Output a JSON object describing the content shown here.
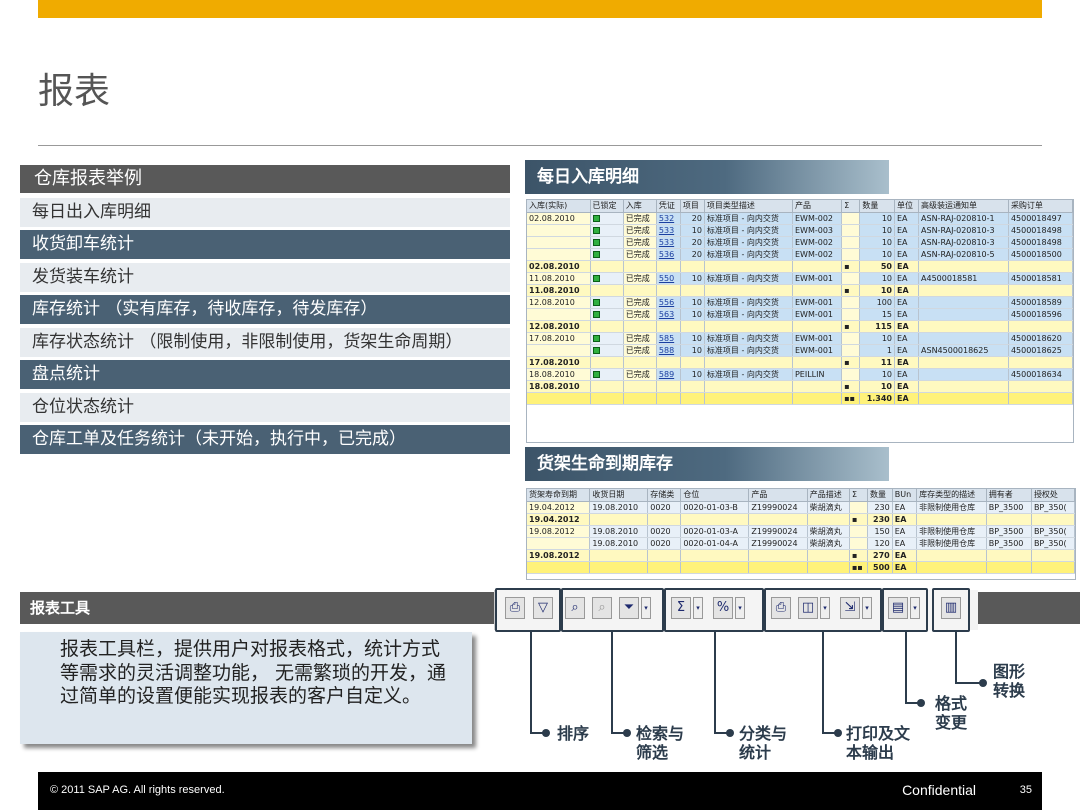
{
  "slide": {
    "title": "报表"
  },
  "left_panel": {
    "heading": "仓库报表举例",
    "items": [
      "每日出入库明细",
      "收货卸车统计",
      "发货装车统计",
      "库存统计 （实有库存，待收库存，待发库存）",
      "库存状态统计 （限制使用，非限制使用，货架生命周期）",
      "盘点统计",
      "仓位状态统计",
      "仓库工单及任务统计（未开始，执行中，已完成）"
    ]
  },
  "panel1": {
    "title": "每日入库明细",
    "headers": [
      "入库(实际)",
      "已锁定",
      "入库",
      "凭证",
      "项目",
      "项目类型描述",
      "产品",
      "Σ",
      "数量",
      "单位",
      "高级装运通知单",
      "采购订单"
    ],
    "rows": [
      {
        "type": "row",
        "date": "02.08.2010",
        "status": "已完成",
        "doc": "532",
        "item": "20",
        "desc": "标准项目 - 向内交货",
        "product": "EWM-002",
        "qty": "10",
        "unit": "EA",
        "asn": "ASN-RAJ-020810-1",
        "po": "4500018497"
      },
      {
        "type": "row",
        "date": "",
        "status": "已完成",
        "doc": "533",
        "item": "10",
        "desc": "标准项目 - 向内交货",
        "product": "EWM-003",
        "qty": "10",
        "unit": "EA",
        "asn": "ASN-RAJ-020810-3",
        "po": "4500018498"
      },
      {
        "type": "row",
        "date": "",
        "status": "已完成",
        "doc": "533",
        "item": "20",
        "desc": "标准项目 - 向内交货",
        "product": "EWM-002",
        "qty": "10",
        "unit": "EA",
        "asn": "ASN-RAJ-020810-3",
        "po": "4500018498"
      },
      {
        "type": "row",
        "date": "",
        "status": "已完成",
        "doc": "536",
        "item": "20",
        "desc": "标准项目 - 向内交货",
        "product": "EWM-002",
        "qty": "10",
        "unit": "EA",
        "asn": "ASN-RAJ-020810-5",
        "po": "4500018500"
      },
      {
        "type": "sub",
        "date": "02.08.2010",
        "mark": "▪",
        "qty": "50",
        "unit": "EA"
      },
      {
        "type": "row",
        "date": "11.08.2010",
        "status": "已完成",
        "doc": "550",
        "item": "10",
        "desc": "标准项目 - 向内交货",
        "product": "EWM-001",
        "qty": "10",
        "unit": "EA",
        "asn": "A4500018581",
        "po": "4500018581"
      },
      {
        "type": "sub",
        "date": "11.08.2010",
        "mark": "▪",
        "qty": "10",
        "unit": "EA"
      },
      {
        "type": "row",
        "date": "12.08.2010",
        "status": "已完成",
        "doc": "556",
        "item": "10",
        "desc": "标准项目 - 向内交货",
        "product": "EWM-001",
        "qty": "100",
        "unit": "EA",
        "asn": "",
        "po": "4500018589"
      },
      {
        "type": "row",
        "date": "",
        "status": "已完成",
        "doc": "563",
        "item": "10",
        "desc": "标准项目 - 向内交货",
        "product": "EWM-001",
        "qty": "15",
        "unit": "EA",
        "asn": "",
        "po": "4500018596"
      },
      {
        "type": "sub",
        "date": "12.08.2010",
        "mark": "▪",
        "qty": "115",
        "unit": "EA"
      },
      {
        "type": "row",
        "date": "17.08.2010",
        "status": "已完成",
        "doc": "585",
        "item": "10",
        "desc": "标准项目 - 向内交货",
        "product": "EWM-001",
        "qty": "10",
        "unit": "EA",
        "asn": "",
        "po": "4500018620"
      },
      {
        "type": "row",
        "date": "",
        "status": "已完成",
        "doc": "588",
        "item": "10",
        "desc": "标准项目 - 向内交货",
        "product": "EWM-001",
        "qty": "1",
        "unit": "EA",
        "asn": "ASN4500018625",
        "po": "4500018625"
      },
      {
        "type": "sub",
        "date": "17.08.2010",
        "mark": "▪",
        "qty": "11",
        "unit": "EA"
      },
      {
        "type": "row",
        "date": "18.08.2010",
        "status": "已完成",
        "doc": "589",
        "item": "10",
        "desc": "标准项目 - 向内交货",
        "product": "PEILLIN",
        "qty": "10",
        "unit": "EA",
        "asn": "",
        "po": "4500018634"
      },
      {
        "type": "sub",
        "date": "18.08.2010",
        "mark": "▪",
        "qty": "10",
        "unit": "EA"
      },
      {
        "type": "tot",
        "date": "",
        "mark": "▪▪",
        "qty": "1.340",
        "unit": "EA"
      }
    ]
  },
  "panel2": {
    "title": "货架生命到期库存",
    "headers": [
      "货架寿命到期",
      "收货日期",
      "存储类",
      "仓位",
      "产品",
      "产品描述",
      "Σ",
      "数量",
      "BUn",
      "库存类型的描述",
      "拥有者",
      "授权处"
    ],
    "rows": [
      {
        "type": "row",
        "exp": "19.04.2012",
        "gr": "19.08.2010",
        "stype": "0020",
        "bin": "0020-01-03-B",
        "product": "Z19990024",
        "pdesc": "柴胡滴丸",
        "qty": "230",
        "unit": "EA",
        "stock": "非限制使用仓库",
        "owner": "BP_3500",
        "auth": "BP_350("
      },
      {
        "type": "sub",
        "exp": "19.04.2012",
        "mark": "▪",
        "qty": "230",
        "unit": "EA"
      },
      {
        "type": "row",
        "exp": "19.08.2012",
        "gr": "19.08.2010",
        "stype": "0020",
        "bin": "0020-01-03-A",
        "product": "Z19990024",
        "pdesc": "柴胡滴丸",
        "qty": "150",
        "unit": "EA",
        "stock": "非限制使用仓库",
        "owner": "BP_3500",
        "auth": "BP_350("
      },
      {
        "type": "row",
        "exp": "",
        "gr": "19.08.2010",
        "stype": "0020",
        "bin": "0020-01-04-A",
        "product": "Z19990024",
        "pdesc": "柴胡滴丸",
        "qty": "120",
        "unit": "EA",
        "stock": "非限制使用仓库",
        "owner": "BP_3500",
        "auth": "BP_350("
      },
      {
        "type": "sub",
        "exp": "19.08.2012",
        "mark": "▪",
        "qty": "270",
        "unit": "EA"
      },
      {
        "type": "tot",
        "exp": "",
        "mark": "▪▪",
        "qty": "500",
        "unit": "EA"
      }
    ]
  },
  "toolbar": {
    "heading": "报表工具",
    "description": "报表工具栏，提供用户对报表格式，统计方式等需求的灵活调整功能， 无需繁琐的开发，通过简单的设置便能实现报表的客户自定义。",
    "labels": {
      "sort": "排序",
      "filter": "检索与筛选",
      "subtotal": "分类与统计",
      "print": "打印及文本输出",
      "layout": "格式变更",
      "graphic": "图形转换"
    }
  },
  "footer": {
    "copyright": "© 2011 SAP AG. All rights reserved.",
    "confidential": "Confidential",
    "page": "35"
  }
}
